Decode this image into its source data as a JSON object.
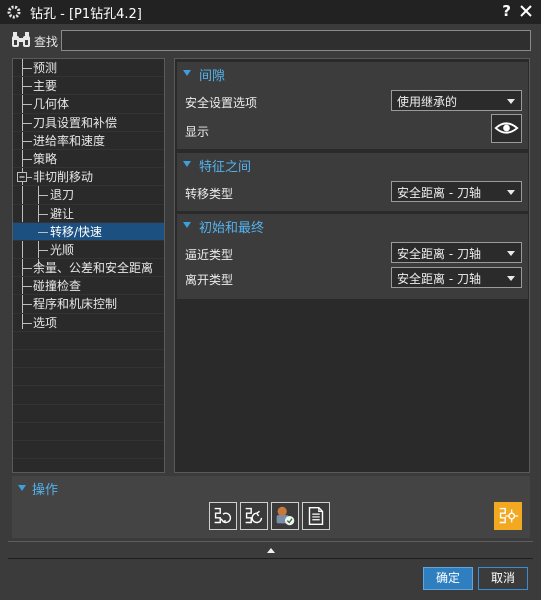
{
  "window": {
    "title": "钻孔 - [P1钻孔4.2]",
    "help": "?",
    "icon": "gear-icon"
  },
  "find": {
    "label": "查找",
    "value": ""
  },
  "tree": {
    "items": [
      {
        "label": "预测",
        "level": 0,
        "selected": false
      },
      {
        "label": "主要",
        "level": 0,
        "selected": false
      },
      {
        "label": "几何体",
        "level": 0,
        "selected": false
      },
      {
        "label": "刀具设置和补偿",
        "level": 0,
        "selected": false
      },
      {
        "label": "进给率和速度",
        "level": 0,
        "selected": false
      },
      {
        "label": "策略",
        "level": 0,
        "selected": false
      },
      {
        "label": "非切削移动",
        "level": 0,
        "selected": false,
        "expanded": true
      },
      {
        "label": "退刀",
        "level": 1,
        "selected": false
      },
      {
        "label": "避让",
        "level": 1,
        "selected": false
      },
      {
        "label": "转移/快速",
        "level": 1,
        "selected": true
      },
      {
        "label": "光顺",
        "level": 1,
        "selected": false
      },
      {
        "label": "余量、公差和安全距离",
        "level": 0,
        "selected": false
      },
      {
        "label": "碰撞检查",
        "level": 0,
        "selected": false
      },
      {
        "label": "程序和机床控制",
        "level": 0,
        "selected": false
      },
      {
        "label": "选项",
        "level": 0,
        "selected": false
      }
    ]
  },
  "sections": {
    "gap": {
      "title": "间隙",
      "safety_label": "安全设置选项",
      "safety_value": "使用继承的",
      "display_label": "显示"
    },
    "between": {
      "title": "特征之间",
      "transfer_label": "转移类型",
      "transfer_value": "安全距离 - 刀轴"
    },
    "initial_final": {
      "title": "初始和最终",
      "approach_label": "逼近类型",
      "approach_value": "安全距离 - 刀轴",
      "depart_label": "离开类型",
      "depart_value": "安全距离 - 刀轴"
    }
  },
  "operations": {
    "title": "操作",
    "buttons": [
      "generate-icon",
      "replay-icon",
      "verify-icon",
      "list-icon",
      "feature-icon"
    ]
  },
  "footer": {
    "ok": "确定",
    "cancel": "取消"
  },
  "colors": {
    "accent": "#53b2ee",
    "selected": "#1c5080",
    "ok": "#2f7fc0",
    "highlight": "#f2a820"
  }
}
